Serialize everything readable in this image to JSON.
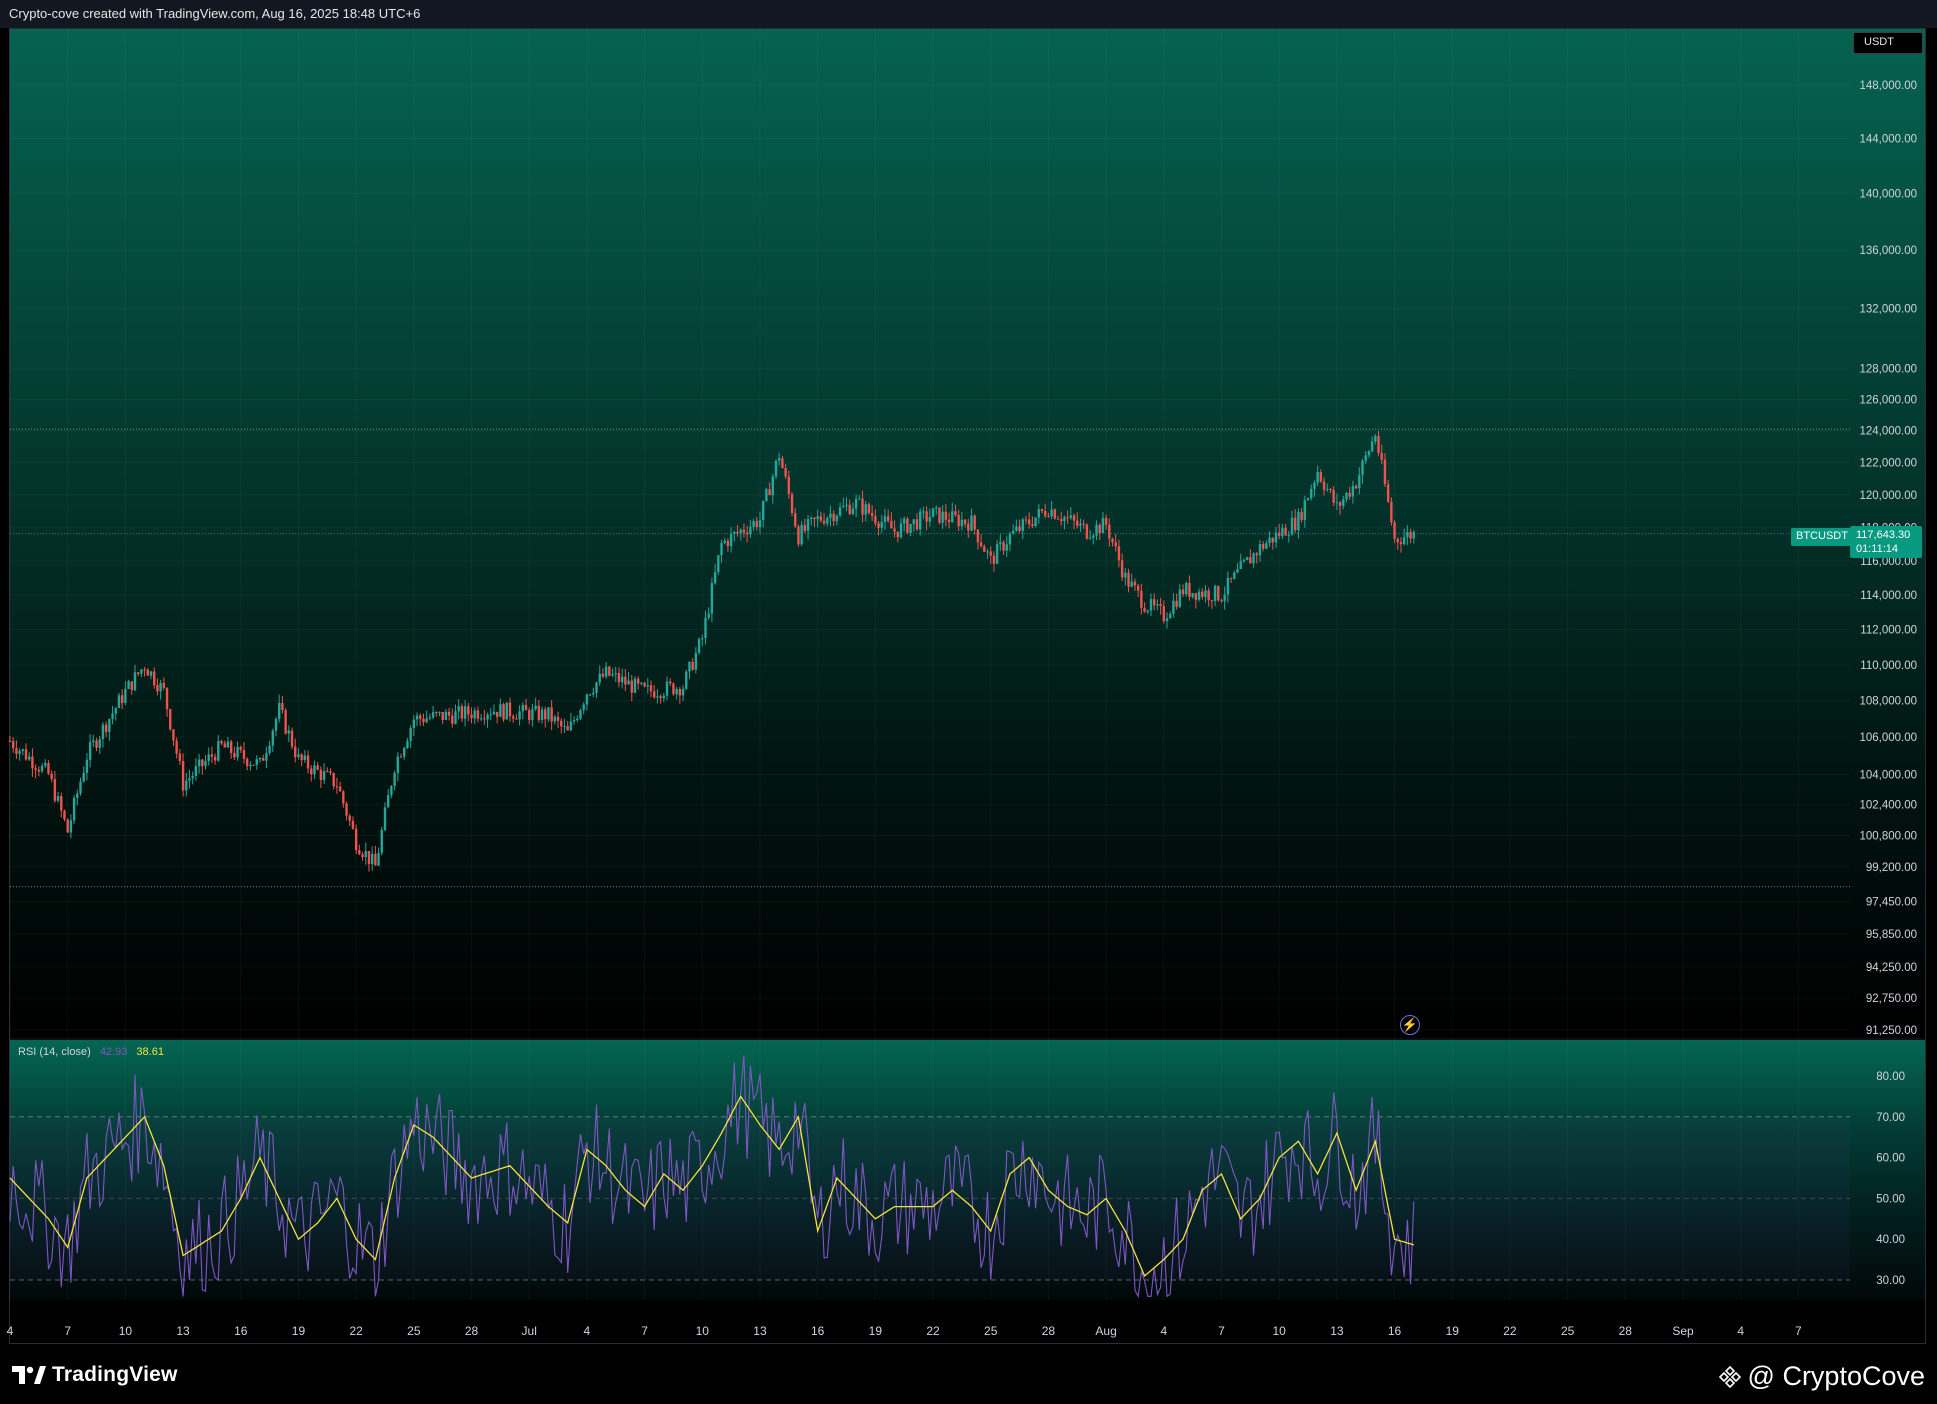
{
  "header": {
    "attribution": "Crypto-cove created with TradingView.com, Aug 16, 2025 18:48 UTC+6"
  },
  "price_axis": {
    "currency": "USDT",
    "labels": [
      "148,000.00",
      "144,000.00",
      "140,000.00",
      "136,000.00",
      "132,000.00",
      "128,000.00",
      "126,000.00",
      "124,000.00",
      "122,000.00",
      "120,000.00",
      "118,000.00",
      "116,000.00",
      "114,000.00",
      "112,000.00",
      "110,000.00",
      "108,000.00",
      "106,000.00",
      "104,000.00",
      "102,400.00",
      "100,800.00",
      "99,200.00",
      "97,450.00",
      "95,850.00",
      "94,250.00",
      "92,750.00",
      "91,250.00"
    ]
  },
  "symbol": {
    "name": "BTCUSDT",
    "last_price": "117,643.30",
    "countdown": "01:11:14"
  },
  "rsi": {
    "title": "RSI (14, close)",
    "value": "42.93",
    "ma_value": "38.61",
    "labels": [
      "80.00",
      "70.00",
      "60.00",
      "50.00",
      "40.00",
      "30.00"
    ]
  },
  "time_axis": {
    "labels": [
      "4",
      "7",
      "10",
      "13",
      "16",
      "19",
      "22",
      "25",
      "28",
      "Jul",
      "4",
      "7",
      "10",
      "13",
      "16",
      "19",
      "22",
      "25",
      "28",
      "Aug",
      "4",
      "7",
      "10",
      "13",
      "16",
      "19",
      "22",
      "25",
      "28",
      "Sep",
      "4",
      "7"
    ]
  },
  "branding": {
    "tradingview": "TradingView",
    "author": "@ CryptoCove"
  },
  "colors": {
    "up": "#26a69a",
    "down": "#ef5350",
    "rsi_line": "#7e57c2",
    "rsi_ma": "#f5e23a",
    "accent": "#089981"
  },
  "chart_data": [
    {
      "type": "candlestick",
      "title": "BTCUSDT",
      "x_unit": "date (2025, 4h candles)",
      "x_range": [
        "2025-06-04",
        "2025-09-08"
      ],
      "y_range": [
        91250,
        150000
      ],
      "y_scale": "log",
      "keypoints": [
        [
          "2025-06-04",
          105800
        ],
        [
          "2025-06-06",
          104000
        ],
        [
          "2025-06-07",
          101000
        ],
        [
          "2025-06-08",
          105000
        ],
        [
          "2025-06-10",
          108500
        ],
        [
          "2025-06-11",
          110000
        ],
        [
          "2025-06-12",
          108500
        ],
        [
          "2025-06-13",
          103500
        ],
        [
          "2025-06-15",
          105500
        ],
        [
          "2025-06-17",
          104500
        ],
        [
          "2025-06-18",
          107500
        ],
        [
          "2025-06-19",
          104800
        ],
        [
          "2025-06-21",
          103500
        ],
        [
          "2025-06-22",
          100500
        ],
        [
          "2025-06-23",
          99200
        ],
        [
          "2025-06-24",
          104500
        ],
        [
          "2025-06-25",
          107000
        ],
        [
          "2025-06-27",
          107200
        ],
        [
          "2025-06-29",
          107500
        ],
        [
          "2025-07-02",
          107200
        ],
        [
          "2025-07-03",
          106200
        ],
        [
          "2025-07-04",
          108500
        ],
        [
          "2025-07-05",
          109500
        ],
        [
          "2025-07-07",
          108500
        ],
        [
          "2025-07-09",
          108800
        ],
        [
          "2025-07-10",
          111500
        ],
        [
          "2025-07-11",
          117000
        ],
        [
          "2025-07-12",
          117800
        ],
        [
          "2025-07-13",
          118500
        ],
        [
          "2025-07-14",
          122500
        ],
        [
          "2025-07-15",
          117500
        ],
        [
          "2025-07-16",
          118500
        ],
        [
          "2025-07-18",
          119500
        ],
        [
          "2025-07-20",
          117800
        ],
        [
          "2025-07-22",
          118800
        ],
        [
          "2025-07-24",
          118300
        ],
        [
          "2025-07-25",
          116000
        ],
        [
          "2025-07-26",
          117500
        ],
        [
          "2025-07-28",
          119200
        ],
        [
          "2025-07-30",
          117800
        ],
        [
          "2025-07-31",
          118200
        ],
        [
          "2025-08-01",
          115000
        ],
        [
          "2025-08-02",
          113500
        ],
        [
          "2025-08-03",
          112800
        ],
        [
          "2025-08-04",
          114300
        ],
        [
          "2025-08-06",
          114000
        ],
        [
          "2025-08-07",
          115500
        ],
        [
          "2025-08-08",
          116800
        ],
        [
          "2025-08-10",
          118500
        ],
        [
          "2025-08-11",
          121500
        ],
        [
          "2025-08-12",
          119200
        ],
        [
          "2025-08-13",
          120800
        ],
        [
          "2025-08-14",
          123800
        ],
        [
          "2025-08-15",
          117300
        ],
        [
          "2025-08-16",
          117643
        ]
      ],
      "range_high": 124100,
      "range_low": 98200,
      "last": 117643.3
    },
    {
      "type": "line",
      "title": "RSI (14, close)",
      "y_range": [
        25,
        85
      ],
      "levels": [
        30,
        50,
        70
      ],
      "series": [
        {
          "name": "RSI",
          "current": 42.93
        },
        {
          "name": "RSI-based MA",
          "current": 38.61
        }
      ],
      "ma_keypoints": [
        [
          "2025-06-04",
          55
        ],
        [
          "2025-06-06",
          45
        ],
        [
          "2025-06-07",
          38
        ],
        [
          "2025-06-08",
          55
        ],
        [
          "2025-06-10",
          65
        ],
        [
          "2025-06-11",
          70
        ],
        [
          "2025-06-12",
          58
        ],
        [
          "2025-06-13",
          36
        ],
        [
          "2025-06-15",
          42
        ],
        [
          "2025-06-16",
          50
        ],
        [
          "2025-06-17",
          60
        ],
        [
          "2025-06-18",
          50
        ],
        [
          "2025-06-19",
          40
        ],
        [
          "2025-06-20",
          44
        ],
        [
          "2025-06-21",
          50
        ],
        [
          "2025-06-22",
          40
        ],
        [
          "2025-06-23",
          35
        ],
        [
          "2025-06-24",
          55
        ],
        [
          "2025-06-25",
          68
        ],
        [
          "2025-06-26",
          65
        ],
        [
          "2025-06-28",
          55
        ],
        [
          "2025-06-30",
          58
        ],
        [
          "2025-07-02",
          48
        ],
        [
          "2025-07-03",
          44
        ],
        [
          "2025-07-04",
          62
        ],
        [
          "2025-07-05",
          58
        ],
        [
          "2025-07-06",
          52
        ],
        [
          "2025-07-07",
          48
        ],
        [
          "2025-07-08",
          56
        ],
        [
          "2025-07-09",
          52
        ],
        [
          "2025-07-10",
          58
        ],
        [
          "2025-07-11",
          66
        ],
        [
          "2025-07-12",
          75
        ],
        [
          "2025-07-13",
          68
        ],
        [
          "2025-07-14",
          62
        ],
        [
          "2025-07-15",
          70
        ],
        [
          "2025-07-16",
          42
        ],
        [
          "2025-07-17",
          55
        ],
        [
          "2025-07-18",
          50
        ],
        [
          "2025-07-19",
          45
        ],
        [
          "2025-07-20",
          48
        ],
        [
          "2025-07-22",
          48
        ],
        [
          "2025-07-23",
          52
        ],
        [
          "2025-07-24",
          48
        ],
        [
          "2025-07-25",
          42
        ],
        [
          "2025-07-26",
          56
        ],
        [
          "2025-07-27",
          60
        ],
        [
          "2025-07-28",
          52
        ],
        [
          "2025-07-29",
          48
        ],
        [
          "2025-07-30",
          46
        ],
        [
          "2025-07-31",
          50
        ],
        [
          "2025-08-01",
          42
        ],
        [
          "2025-08-02",
          31
        ],
        [
          "2025-08-03",
          35
        ],
        [
          "2025-08-04",
          40
        ],
        [
          "2025-08-05",
          52
        ],
        [
          "2025-08-06",
          56
        ],
        [
          "2025-08-07",
          45
        ],
        [
          "2025-08-08",
          50
        ],
        [
          "2025-08-09",
          60
        ],
        [
          "2025-08-10",
          64
        ],
        [
          "2025-08-11",
          56
        ],
        [
          "2025-08-12",
          66
        ],
        [
          "2025-08-13",
          52
        ],
        [
          "2025-08-14",
          64
        ],
        [
          "2025-08-15",
          40
        ],
        [
          "2025-08-16",
          38.61
        ]
      ]
    }
  ]
}
